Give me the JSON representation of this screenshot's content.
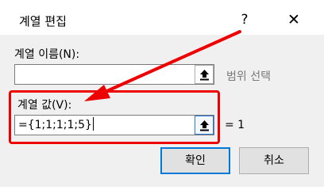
{
  "dialog": {
    "title": "계열 편집",
    "help_label": "?",
    "close_label": "✕"
  },
  "series_name": {
    "label": "계열 이름(N):",
    "value": "",
    "hint": "범위 선택"
  },
  "series_values": {
    "label": "계열 값(V):",
    "value": "={1;1;1;1;5}",
    "result": "= 1"
  },
  "buttons": {
    "ok_label": "확인",
    "cancel_label": "취소"
  },
  "icons": {
    "range_picker": "collapse-dialog-icon",
    "annotation": "red-arrow-icon"
  },
  "colors": {
    "highlight": "#ee0000",
    "focus": "#0078d7"
  }
}
